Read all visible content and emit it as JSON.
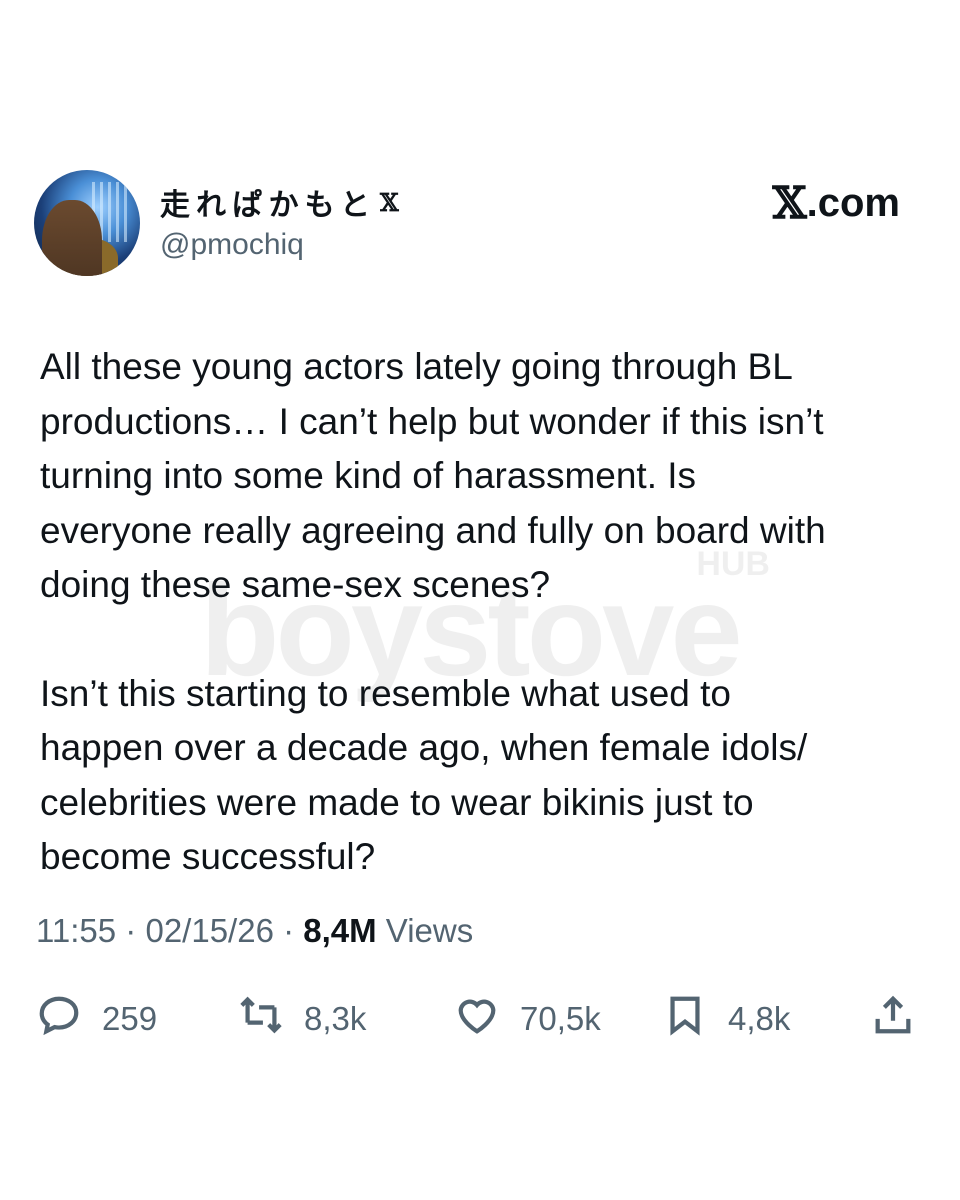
{
  "author": {
    "display_name": "走れぱかもと",
    "verified_glyph": "𝕏",
    "handle": "@pmochiq"
  },
  "brand": {
    "glyph": "𝕏",
    "label": ".com"
  },
  "tweet": {
    "paragraphs": [
      "All these young actors lately going through BL\nproductions… I can’t help but wonder if this isn’t\nturning into some kind of harassment. Is\neveryone really agreeing and fully on board with\ndoing these same-sex scenes?",
      "Isn’t this starting to resemble what used to\nhappen over a decade ago, when female idols/\ncelebrities were made to wear bikinis just to\nbecome successful?"
    ]
  },
  "watermark": {
    "text": "boystove",
    "sub": "HUB"
  },
  "meta": {
    "time": "11:55",
    "sep1": " · ",
    "date": "02/15/26",
    "sep2": " · ",
    "views_count": "8,4M",
    "views_label": " Views"
  },
  "actions": {
    "reply": {
      "icon": "reply-icon",
      "count": "259"
    },
    "retweet": {
      "icon": "retweet-icon",
      "count": "8,3k"
    },
    "like": {
      "icon": "heart-icon",
      "count": "70,5k"
    },
    "bookmark": {
      "icon": "bookmark-icon",
      "count": "4,8k"
    },
    "share": {
      "icon": "share-icon"
    }
  },
  "colors": {
    "text": "#0f1419",
    "secondary": "#536471",
    "background": "#ffffff"
  }
}
